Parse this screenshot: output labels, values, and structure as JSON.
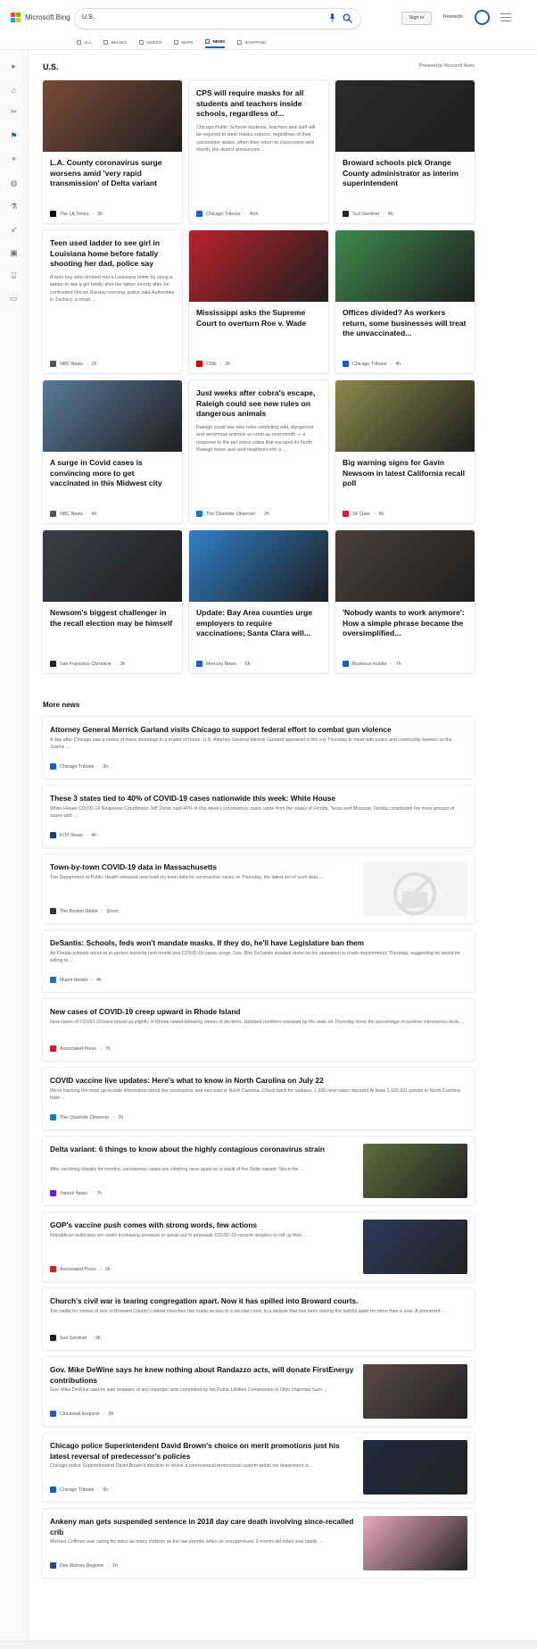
{
  "header": {
    "brand": "Microsoft Bing",
    "query": "U.S.",
    "signin_label": "Sign in",
    "rewards_label": "Rewards",
    "tabs": [
      {
        "label": "ALL",
        "icon": "search-icon"
      },
      {
        "label": "IMAGES",
        "icon": "image-icon"
      },
      {
        "label": "VIDEOS",
        "icon": "video-icon"
      },
      {
        "label": "MAPS",
        "icon": "map-pin-icon"
      },
      {
        "label": "NEWS",
        "icon": "news-icon",
        "active": true
      },
      {
        "label": "SHOPPING",
        "icon": "shopping-bag-icon"
      }
    ]
  },
  "sidebar": {
    "icons": [
      "chevron-right-icon",
      "home-icon",
      "scissors-icon",
      "flag-icon",
      "location-icon",
      "globe-icon",
      "microscope-icon",
      "rocket-icon",
      "film-icon",
      "building-icon",
      "card-icon"
    ]
  },
  "section": {
    "title": "U.S.",
    "powered": "Powered by Microsoft News"
  },
  "cards": [
    {
      "title": "L.A. County coronavirus surge worsens amid 'very rapid transmission' of Delta variant",
      "excerpt": "",
      "source": "The LA Times",
      "time": "3h",
      "has_image": true,
      "img_color": "#7a4a38",
      "src_color": "#111111"
    },
    {
      "title": "CPS will require masks for all students and teachers inside schools, regardless of...",
      "excerpt": "Chicago Public Schools students, teachers and staff will be required to wear masks indoors, regardless of their vaccination status, when they return to classrooms next month, the district announced ...",
      "source": "Chicago Tribune",
      "time": "45m",
      "has_image": false,
      "img_color": "",
      "src_color": "#1a5dd0"
    },
    {
      "title": "Broward schools pick Orange County administrator as interim superintendent",
      "excerpt": "",
      "source": "Sun Sentinel",
      "time": "4h",
      "has_image": true,
      "img_color": "#2d2a2c",
      "src_color": "#222222"
    },
    {
      "title": "Teen used ladder to see girl in Louisiana home before fatally shooting her dad, police say",
      "excerpt": "A teen boy who climbed into a Louisiana home by using a ladder to see a girl fatally shot her father shortly after he confronted him on Sunday morning, police said.Authorities in Zachary, a small ...",
      "source": "NBC News",
      "time": "2h",
      "has_image": false,
      "img_color": "",
      "src_color": "#555555"
    },
    {
      "title": "Mississippi asks the Supreme Court to overturn Roe v. Wade",
      "excerpt": "",
      "source": "CNN",
      "time": "3h",
      "has_image": true,
      "img_color": "#b8232c",
      "src_color": "#cc0000"
    },
    {
      "title": "Offices divided? As workers return, some businesses will treat the unvaccinated...",
      "excerpt": "",
      "source": "Chicago Tribune",
      "time": "4h",
      "has_image": true,
      "img_color": "#3e8a4c",
      "src_color": "#1a5dd0"
    },
    {
      "title": "A surge in Covid cases is convincing more to get vaccinated in this Midwest city",
      "excerpt": "",
      "source": "NBC News",
      "time": "4h",
      "has_image": true,
      "img_color": "#5a7a9a",
      "src_color": "#555555"
    },
    {
      "title": "Just weeks after cobra's escape, Raleigh could see new rules on dangerous animals",
      "excerpt": "Raleigh could see new rules restricting wild, dangerous and venomous animals as soon as next month — a response to the pet zebra cobra that escaped its North Raleigh home and sent neighbors into a ...",
      "source": "The Charlotte Observer",
      "time": "2h",
      "has_image": false,
      "img_color": "",
      "src_color": "#1a7dc0"
    },
    {
      "title": "Big warning signs for Gavin Newsom in latest California recall poll",
      "excerpt": "",
      "source": "SF Gate",
      "time": "9h",
      "has_image": true,
      "img_color": "#8a8a4a",
      "src_color": "#d02040"
    },
    {
      "title": "Newsom's biggest challenger in the recall election may be himself",
      "excerpt": "",
      "source": "San Francisco Chronicle",
      "time": "3h",
      "has_image": true,
      "img_color": "#3a3f4a",
      "src_color": "#222222"
    },
    {
      "title": "Update: Bay Area counties urge employers to require vaccinations; Santa Clara will...",
      "excerpt": "",
      "source": "Mercury News",
      "time": "6h",
      "has_image": true,
      "img_color": "#2f7fc8",
      "src_color": "#1a5dd0"
    },
    {
      "title": "'Nobody wants to work anymore': How a simple phrase became the oversimplified...",
      "excerpt": "",
      "source": "Business Insider",
      "time": "7h",
      "has_image": true,
      "img_color": "#4a4038",
      "src_color": "#1a5dd0"
    }
  ],
  "more": {
    "title": "More news",
    "items": [
      {
        "title": "Attorney General Merrick Garland visits Chicago to support federal effort to combat gun violence",
        "excerpt": "A day after Chicago saw a series of mass shootings in a matter of hours, U.S. Attorney General Merrick Garland appeared in the city Thursday to meet with police and community leaders as the Justice ...",
        "source": "Chicago Tribune",
        "time": "3h",
        "thumb": "",
        "src_color": "#1a5dd0"
      },
      {
        "title": "These 3 states tied to 40% of COVID-19 cases nationwide this week: White House",
        "excerpt": "White House COVID-19 Response Coordinator Jeff Zients said 40% of this week's coronavirus cases came from the states of Florida, Texas and Missouri. Florida contributed the most amount of cases with ...",
        "source": "FOX News",
        "time": "4h",
        "thumb": "",
        "src_color": "#1a3d7c"
      },
      {
        "title": "Town-by-town COVID-19 data in Massachusetts",
        "excerpt": "The Department of Public Health released new town-by-town data for coronavirus cases on Thursday, the latest set of such data ...",
        "source": "The Boston Globe",
        "time": "2mon",
        "thumb": "placeholder",
        "src_color": "#333333"
      },
      {
        "title": "DeSantis: Schools, feds won't mandate masks. If they do, he'll have Legislature ban them",
        "excerpt": "As Florida schools return to in-person learning next month and COVID-19 cases surge, Gov. Ron DeSantis doubled down on his opposition to mask requirements Thursday, suggesting he would be willing to ...",
        "source": "Miami Herald",
        "time": "4h",
        "thumb": "",
        "src_color": "#2a6ab8"
      },
      {
        "title": "New cases of COVID-19 creep upward in Rhode Island",
        "excerpt": "New cases of COVID-19 have ticked up slightly in Rhode Island following weeks of declines. Updated numbers released by the state on Thursday show the percentage of positive coronavirus tests ...",
        "source": "Associated Press",
        "time": "7h",
        "thumb": "",
        "src_color": "#d02020"
      },
      {
        "title": "COVID vaccine live updates: Here's what to know in North Carolina on July 22",
        "excerpt": "We're tracking the most up-to-date information about the coronavirus and vaccines in North Carolina. Check back for updates. 1,800 new cases reported At least 1,029,931 people in North Carolina have ...",
        "source": "The Charlotte Observer",
        "time": "7h",
        "thumb": "",
        "src_color": "#1a7dc0"
      },
      {
        "title": "Delta variant: 6 things to know about the highly contagious coronavirus strain",
        "excerpt": "After declining sharply for months, coronavirus cases are climbing once again as a result of the Delta variant. Since the ...",
        "source": "Yahoo! News",
        "time": "7h",
        "thumb": "photo",
        "thumb_color": "#5c6e3a",
        "src_color": "#6a1fd0"
      },
      {
        "title": "GOP's vaccine push comes with strong words, few actions",
        "excerpt": "Republican politicians are under increasing pressure to speak out to persuade COVID-19 vaccine skeptics to roll up their ...",
        "source": "Associated Press",
        "time": "2h",
        "thumb": "photo",
        "thumb_color": "#2d3a5c",
        "src_color": "#d02020"
      },
      {
        "title": "Church's civil war is tearing congregation apart. Now it has spilled into Broward courts.",
        "excerpt": "The battle for control of one of Broward County's oldest churches has made its way to a secular court, in a dispute that has been tearing the faithful apart for more than a year. A prominent ...",
        "source": "Sun Sentinel",
        "time": "3h",
        "thumb": "",
        "src_color": "#222222"
      },
      {
        "title": "Gov. Mike DeWine says he knew nothing about Randazzo acts, will donate FirstEnergy contributions",
        "excerpt": "Gov. Mike DeWine said he was unaware of any improper acts committed by his Public Utilities Commission of Ohio chairman Sam ...",
        "source": "Cincinnati Enquirer",
        "time": "3h",
        "thumb": "photo",
        "thumb_color": "#5a4a48",
        "src_color": "#2a5ab8"
      },
      {
        "title": "Chicago police Superintendent David Brown's choice on merit promotions just his latest reversal of predecessor's policies",
        "excerpt": "Chicago police Superintendent David Brown's decision to revive a controversial promotional system within his department is ...",
        "source": "Chicago Tribune",
        "time": "6h",
        "thumb": "photo",
        "thumb_color": "#1e2a40",
        "src_color": "#1a5dd0"
      },
      {
        "title": "Ankeny man gets suspended sentence in 2018 day care death involving since-recalled crib",
        "excerpt": "Michael Coffman was caring for twice as many children as the law permits when an unsupervised, 2-month-old infant was fatally ...",
        "source": "Des Moines Register",
        "time": "1h",
        "thumb": "photo",
        "thumb_color": "#e8a8c0",
        "src_color": "#2a4a90"
      }
    ]
  }
}
